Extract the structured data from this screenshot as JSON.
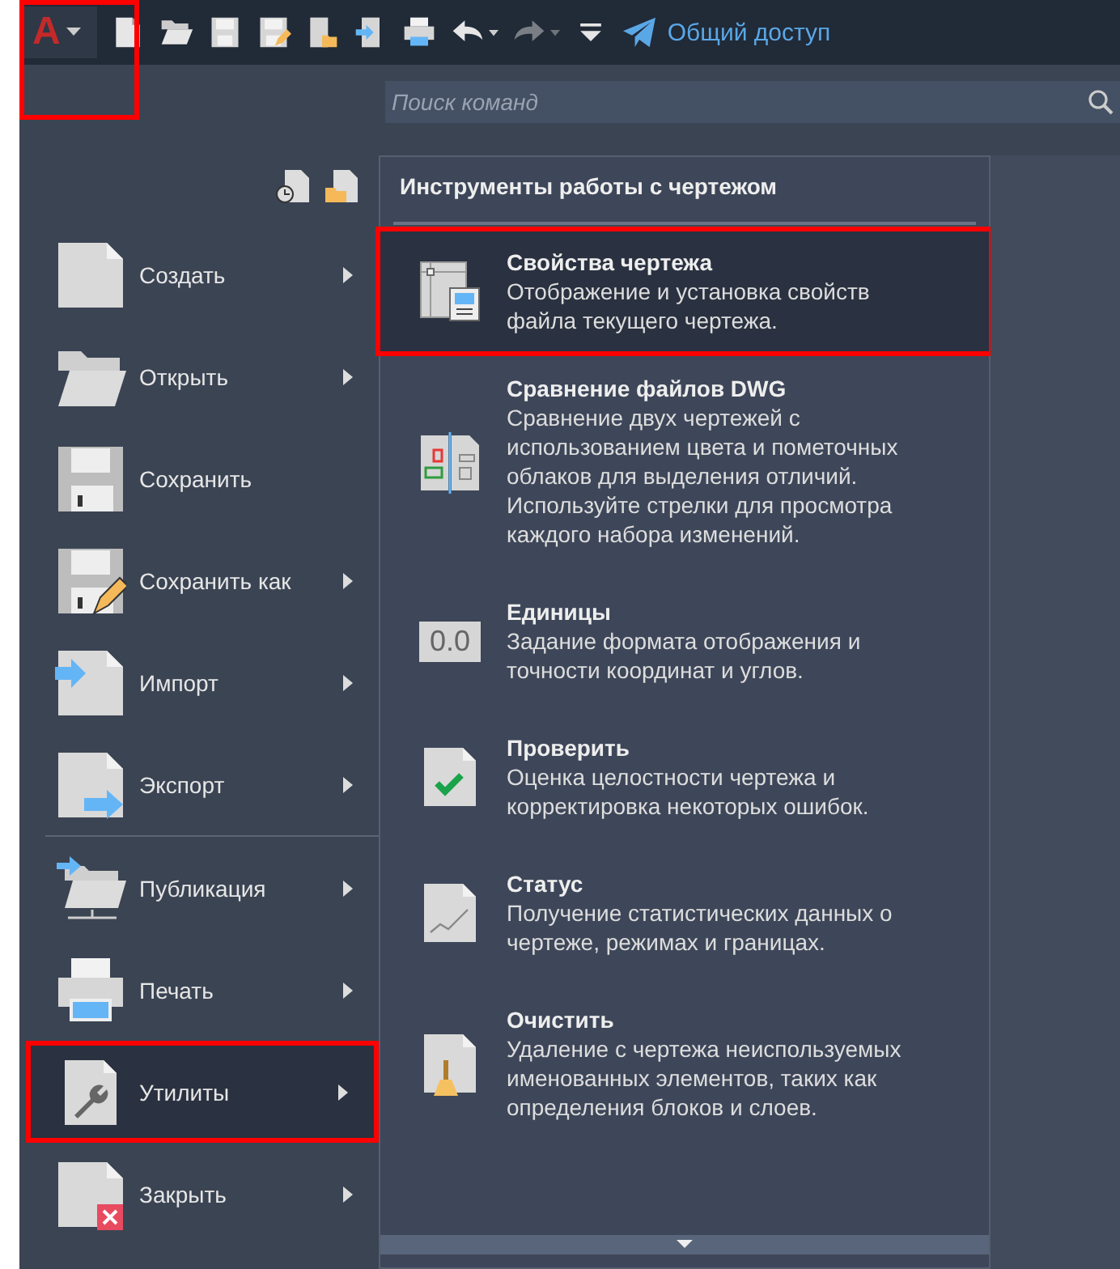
{
  "app_button": {
    "logo": "A",
    "highlighted": true
  },
  "toolbar": [
    {
      "kind": "new",
      "disabled": false
    },
    {
      "kind": "open",
      "disabled": false
    },
    {
      "kind": "save",
      "disabled": false
    },
    {
      "kind": "saveas",
      "disabled": false
    },
    {
      "kind": "openweb",
      "disabled": false
    },
    {
      "kind": "savemobile",
      "disabled": false
    },
    {
      "kind": "print",
      "disabled": false
    },
    {
      "kind": "undo",
      "disabled": false
    },
    {
      "kind": "caret",
      "disabled": false
    },
    {
      "kind": "redo",
      "disabled": true
    },
    {
      "kind": "caret",
      "disabled": true
    },
    {
      "kind": "customize",
      "disabled": false
    }
  ],
  "share": {
    "label": "Общий доступ"
  },
  "search": {
    "placeholder": "Поиск команд"
  },
  "menu": [
    {
      "kind": "new",
      "label": "Создать",
      "submenu": true,
      "highlighted": false,
      "separator_after": false
    },
    {
      "kind": "open",
      "label": "Открыть",
      "submenu": true,
      "highlighted": false,
      "separator_after": false
    },
    {
      "kind": "save",
      "label": "Сохранить",
      "submenu": false,
      "highlighted": false,
      "separator_after": false
    },
    {
      "kind": "saveas",
      "label": "Сохранить как",
      "submenu": true,
      "highlighted": false,
      "separator_after": false
    },
    {
      "kind": "import",
      "label": "Импорт",
      "submenu": true,
      "highlighted": false,
      "separator_after": false
    },
    {
      "kind": "export",
      "label": "Экспорт",
      "submenu": true,
      "highlighted": false,
      "separator_after": true
    },
    {
      "kind": "publish",
      "label": "Публикация",
      "submenu": true,
      "highlighted": false,
      "separator_after": false
    },
    {
      "kind": "print",
      "label": "Печать",
      "submenu": true,
      "highlighted": false,
      "separator_after": false
    },
    {
      "kind": "utilities",
      "label": "Утилиты",
      "submenu": true,
      "highlighted": true,
      "separator_after": false
    },
    {
      "kind": "close",
      "label": "Закрыть",
      "submenu": true,
      "highlighted": false,
      "separator_after": false
    }
  ],
  "panel": {
    "title": "Инструменты работы с чертежом",
    "items": [
      {
        "kind": "properties",
        "title": "Свойства чертежа",
        "description": "Отображение и установка свойств файла текущего чертежа.",
        "highlighted": true
      },
      {
        "kind": "compare",
        "title": "Сравнение файлов DWG",
        "description": "Сравнение двух чертежей с использованием цвета и пометочных облаков для выделения отличий. Используйте стрелки для просмотра каждого набора изменений.",
        "highlighted": false
      },
      {
        "kind": "units",
        "title": "Единицы",
        "description": "Задание формата отображения и точности координат и углов.",
        "highlighted": false,
        "icon_text": "0.0"
      },
      {
        "kind": "audit",
        "title": "Проверить",
        "description": "Оценка целостности чертежа и корректировка некоторых ошибок.",
        "highlighted": false
      },
      {
        "kind": "status",
        "title": "Статус",
        "description": "Получение статистических данных о чертеже, режимах и границах.",
        "highlighted": false
      },
      {
        "kind": "purge",
        "title": "Очистить",
        "description": "Удаление с чертежа неиспользуемых именованных элементов, таких как определения блоков и слоев.",
        "highlighted": false
      }
    ]
  }
}
